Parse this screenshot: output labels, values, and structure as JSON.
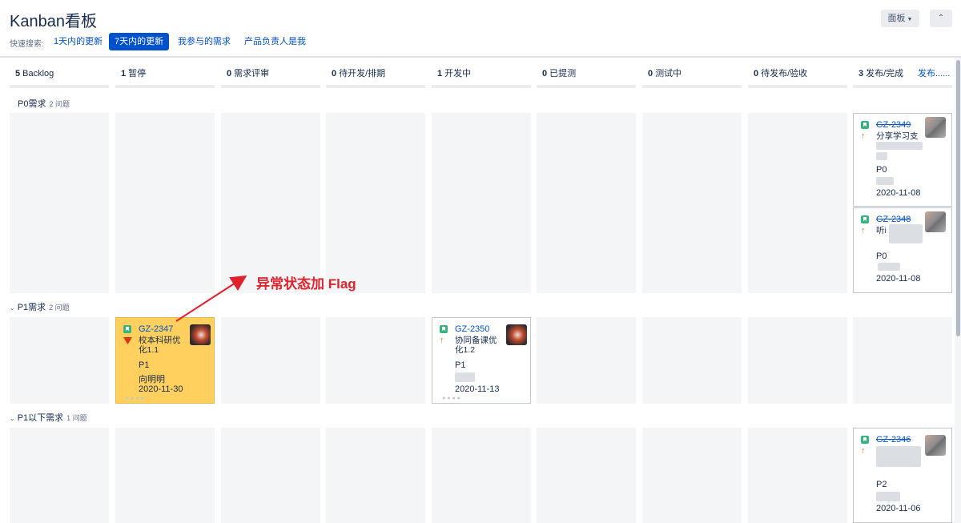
{
  "header": {
    "title": "Kanban看板",
    "board_button": "面板",
    "collapse_button": "«"
  },
  "quick_search": {
    "label": "快速搜索:",
    "filters": [
      {
        "label": "1天内的更新",
        "active": false
      },
      {
        "label": "7天内的更新",
        "active": true
      },
      {
        "label": "我参与的需求",
        "active": false
      },
      {
        "label": "产品负责人是我",
        "active": false
      }
    ]
  },
  "columns": [
    {
      "count": "5",
      "name": "Backlog"
    },
    {
      "count": "1",
      "name": "暂停"
    },
    {
      "count": "0",
      "name": "需求评审"
    },
    {
      "count": "0",
      "name": "待开发/排期"
    },
    {
      "count": "1",
      "name": "开发中"
    },
    {
      "count": "0",
      "name": "已提测"
    },
    {
      "count": "0",
      "name": "测试中"
    },
    {
      "count": "0",
      "name": "待发布/验收"
    },
    {
      "count": "3",
      "name": "发布/完成"
    }
  ],
  "release_link": "发布......",
  "swimlanes": [
    {
      "name": "P0需求",
      "issues": "2 问题"
    },
    {
      "name": "P1需求",
      "issues": "2 问题"
    },
    {
      "name": "P1以下需求",
      "issues": "1 问题"
    }
  ],
  "cards": {
    "c2349": {
      "key": "GZ-2349",
      "summary": "分享学习支",
      "priority_text": "P0",
      "date": "2020-11-08",
      "priority_icon": "arrow-up-icon",
      "done": true
    },
    "c2348": {
      "key": "GZ-2348",
      "summary": "听i",
      "priority_text": "P0",
      "date": "2020-11-08",
      "priority_icon": "arrow-up-icon",
      "done": true
    },
    "c2347": {
      "key": "GZ-2347",
      "summary": "校本科研优化1.1",
      "priority_text": "P1",
      "assignee": "向明明",
      "date": "2020-11-30",
      "priority_icon": "flag-icon",
      "flagged": true
    },
    "c2350": {
      "key": "GZ-2350",
      "summary": "协同备课优化1.2",
      "priority_text": "P1",
      "date": "2020-11-13",
      "priority_icon": "arrow-up-icon"
    },
    "c2346": {
      "key": "GZ-2346",
      "priority_text": "P2",
      "date": "2020-11-06",
      "priority_icon": "arrow-up-icon",
      "done": true
    }
  },
  "annotation": {
    "text": "异常状态加 Flag",
    "color": "#e0222b"
  },
  "colors": {
    "accent": "#0052cc",
    "flagged_card": "#ffd05e",
    "story_icon": "#36b37e",
    "column_bg": "#f4f5f7"
  }
}
